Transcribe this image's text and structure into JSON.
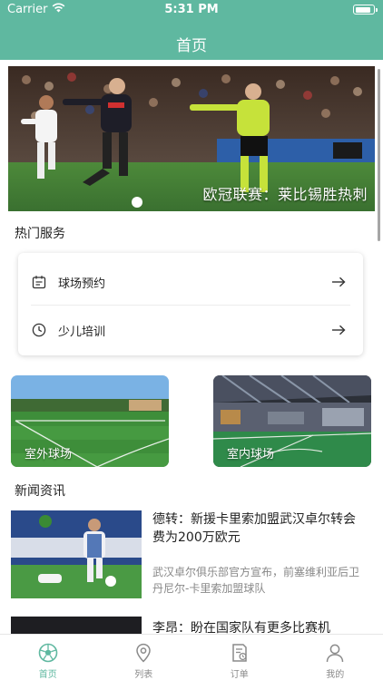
{
  "status_bar": {
    "carrier": "Carrier",
    "time": "5:31 PM",
    "battery_level": 0.9
  },
  "nav": {
    "title": "首页"
  },
  "banner": {
    "caption": "欧冠联赛：莱比锡胜热刺"
  },
  "hot_services": {
    "title": "热门服务",
    "items": [
      {
        "label": "球场预约",
        "icon": "calendar-icon"
      },
      {
        "label": "少儿培训",
        "icon": "clock-icon"
      }
    ]
  },
  "venues": [
    {
      "label": "室外球场"
    },
    {
      "label": "室内球场"
    }
  ],
  "news": {
    "title": "新闻资讯",
    "items": [
      {
        "title": "德转：新援卡里索加盟武汉卓尔转会费为200万欧元",
        "summary": "武汉卓尔俱乐部官方宣布，前塞维利亚后卫丹尼尔-卡里索加盟球队"
      },
      {
        "title": "李昂：盼在国家队有更多比赛机",
        "summary": ""
      }
    ]
  },
  "tabbar": {
    "tabs": [
      {
        "label": "首页",
        "icon": "soccer-ball-icon",
        "active": true
      },
      {
        "label": "列表",
        "icon": "location-pin-icon",
        "active": false
      },
      {
        "label": "订单",
        "icon": "order-document-icon",
        "active": false
      },
      {
        "label": "我的",
        "icon": "user-icon",
        "active": false
      }
    ]
  },
  "colors": {
    "accent": "#5fb8a0",
    "text": "#222222",
    "muted": "#888888"
  }
}
